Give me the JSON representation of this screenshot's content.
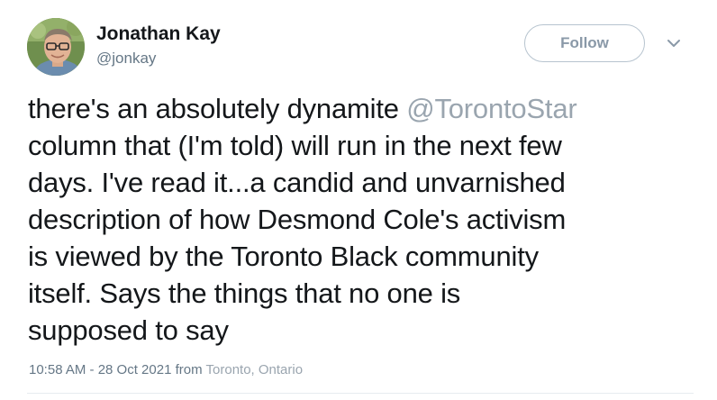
{
  "author": {
    "display_name": "Jonathan Kay",
    "handle": "@jonkay",
    "avatar_icon": "profile-photo"
  },
  "follow_button": {
    "label": "Follow"
  },
  "menu": {
    "icon": "chevron-down-icon"
  },
  "tweet": {
    "lines": [
      {
        "before": "there's an absolutely dynamite ",
        "mention": "@TorontoStar"
      },
      {
        "text": "column that (I'm told) will run in the next few"
      },
      {
        "text": "days. I've read it...a candid and unvarnished"
      },
      {
        "text": "description of how Desmond Cole's activism"
      },
      {
        "text": "is viewed by the Toronto Black community"
      },
      {
        "text": "itself. Says the things that no one is"
      },
      {
        "text": "supposed to say"
      }
    ]
  },
  "meta": {
    "timestamp": "10:58 AM - 28 Oct 2021",
    "from_label": "from",
    "location": "Toronto, Ontario"
  },
  "colors": {
    "text_primary": "#14171a",
    "text_secondary": "#657786",
    "mention": "#9aa5af",
    "button_border": "#b7c4cf",
    "divider": "#e6ecf0"
  }
}
